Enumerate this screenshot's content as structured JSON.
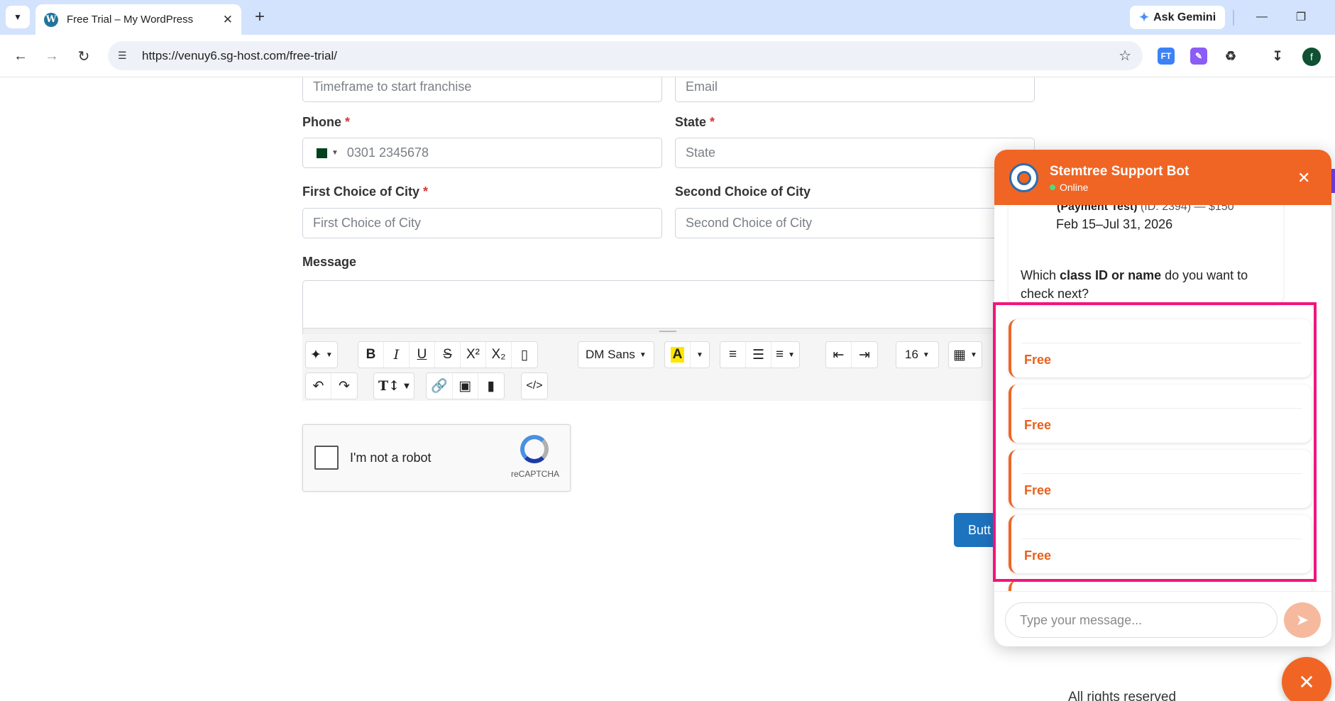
{
  "browser": {
    "tab_title": "Free Trial – My WordPress",
    "url": "https://venuy6.sg-host.com/free-trial/",
    "gemini_label": "Ask Gemini",
    "profile_initial": "f",
    "ext1_label": "FT"
  },
  "form": {
    "timeframe_placeholder": "Timeframe to start franchise",
    "email_placeholder": "Email",
    "phone_label": "Phone",
    "phone_placeholder": "0301 2345678",
    "state_label": "State",
    "state_placeholder": "State",
    "first_city_label": "First Choice of City",
    "first_city_placeholder": "First Choice of City",
    "second_city_label": "Second Choice of City",
    "second_city_placeholder": "Second Choice of City",
    "message_label": "Message",
    "required_mark": "*",
    "font_name": "DM Sans",
    "font_size": "16",
    "recaptcha_label": "I'm not a robot",
    "recaptcha_brand": "reCAPTCHA",
    "submit_label": "Butt",
    "footer_text": "All rights reserved"
  },
  "chat": {
    "title": "Stemtree Support Bot",
    "status": "Online",
    "cut_text": "(Payment Test)",
    "cut_muted": "(ID: 2394) — $150",
    "dates": "Feb 15–Jul 31, 2026",
    "question_pre": "Which ",
    "question_bold": "class ID or name",
    "question_post": " do you want to check next?",
    "options": [
      {
        "price": "Free"
      },
      {
        "price": "Free"
      },
      {
        "price": "Free"
      },
      {
        "price": "Free"
      }
    ],
    "input_placeholder": "Type your message..."
  }
}
